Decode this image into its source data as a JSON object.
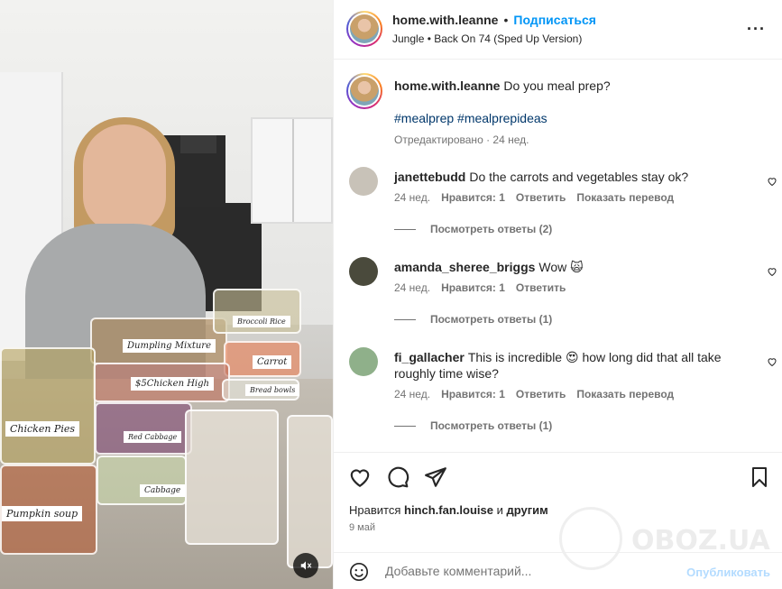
{
  "post": {
    "username": "home.with.leanne",
    "follow_label": "Подписаться",
    "separator": "•",
    "audio": "Jungle • Back On 74 (Sped Up Version)",
    "caption_user": "home.with.leanne",
    "caption_text": "Do you meal prep?",
    "hashtags": "#mealprep #mealprepideas",
    "edited": "Отредактировано · 24 нед."
  },
  "media": {
    "labels": [
      "Dumpling Mixture",
      "Broccoli Rice",
      "Carrot",
      "$5Chicken High",
      "Chicken Pies",
      "Red Cabbage",
      "Cabbage",
      "Bread bowls",
      "Pumpkin soup"
    ]
  },
  "comments": [
    {
      "user": "janettebudd",
      "text": "Do the carrots and vegetables stay ok?",
      "time": "24 нед.",
      "likes": "Нравится: 1",
      "reply": "Ответить",
      "translate": "Показать перевод",
      "view_replies": "Посмотреть ответы (2)",
      "avatar_color": "#c8c2b8"
    },
    {
      "user": "amanda_sheree_briggs",
      "text": "Wow 🙀",
      "time": "24 нед.",
      "likes": "Нравится: 1",
      "reply": "Ответить",
      "view_replies": "Посмотреть ответы (1)",
      "avatar_color": "#4a4a3c"
    },
    {
      "user": "fi_gallacher",
      "text": "This is incredible 😍 how long did that all take roughly time wise?",
      "time": "24 нед.",
      "likes": "Нравится: 1",
      "reply": "Ответить",
      "translate": "Показать перевод",
      "view_replies": "Посмотреть ответы (1)",
      "avatar_color": "#8fb08a"
    }
  ],
  "footer": {
    "likes_prefix": "Нравится",
    "likes_user": "hinch.fan.louise",
    "likes_and": "и",
    "likes_others": "другим",
    "date": "9 май",
    "comment_placeholder": "Добавьте комментарий...",
    "post_label": "Опубликовать",
    "watermark": "OBOZ.UA"
  },
  "icons": {
    "more": "more-options-icon",
    "like": "heart-icon",
    "comment": "comment-icon",
    "share": "share-icon",
    "save": "bookmark-icon",
    "emoji": "emoji-icon",
    "mute": "muted-speaker-icon"
  }
}
